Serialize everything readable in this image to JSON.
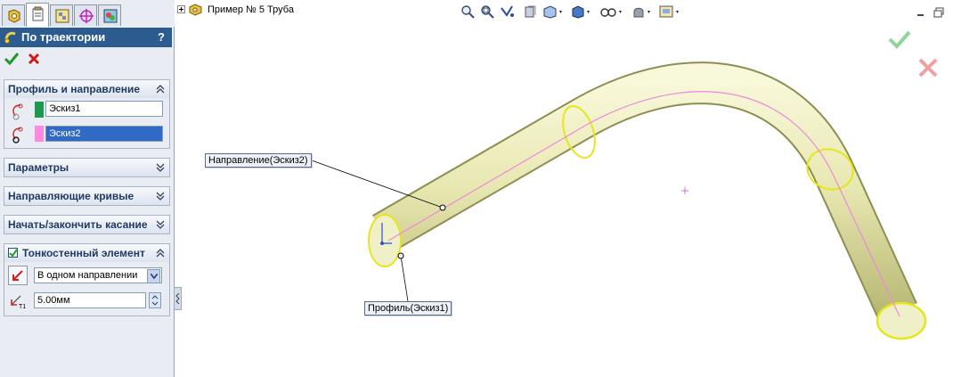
{
  "panel": {
    "title": "По траектории",
    "help": "?",
    "groups": {
      "profile_direction": {
        "label": "Профиль и направление",
        "profile_value": "Эскиз1",
        "path_value": "Эскиз2"
      },
      "parameters": {
        "label": "Параметры"
      },
      "guide_curves": {
        "label": "Направляющие кривые"
      },
      "tangency": {
        "label": "Начать/закончить касание"
      },
      "thin_feature": {
        "label": "Тонкостенный элемент",
        "checked": true,
        "direction_value": "В одном направлении",
        "thickness_value": "5.00мм"
      }
    }
  },
  "tree": {
    "item_label": "Пример № 5 Труба"
  },
  "callouts": {
    "path": "Направление(Эскиз2)",
    "profile": "Профиль(Эскиз1)"
  },
  "colors": {
    "title_bar": "#2c5c8f",
    "profile_swatch": "#1a9a4a",
    "path_swatch": "#ff88e0",
    "pipe_fill": "#eeeebb",
    "pipe_edge": "#cccc00",
    "path_line": "#ee88dd"
  },
  "icons": {
    "ok": "check-icon",
    "cancel": "x-icon"
  }
}
